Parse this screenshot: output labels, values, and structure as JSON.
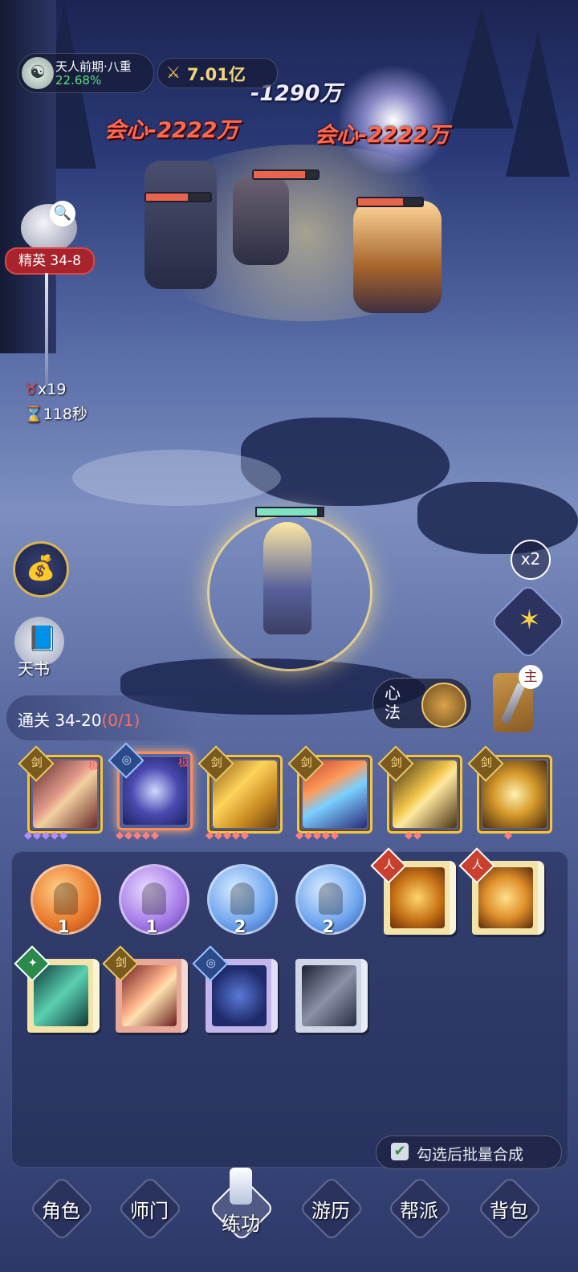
{
  "hud": {
    "realm_title": "天人前期·八重",
    "realm_progress": "22.68%",
    "power_value": "7.01亿",
    "avatar_icon": "sage-avatar-icon",
    "power_icon": "crossed-swords-icon"
  },
  "damage_texts": {
    "white_hit": "-1290万",
    "crit_left": "会心-2222万",
    "crit_right": "会心-2222万"
  },
  "stage": {
    "badge": "精英 34-8",
    "kills": "x19",
    "time": "118秒",
    "clear_label": "通关 34-20",
    "clear_progress": "(0/1)"
  },
  "side": {
    "tianshu_label": "天书",
    "speed_label": "x2",
    "xinfa_label": "心法",
    "weapon_badge": "主"
  },
  "skill_cards": [
    {
      "tag": "剑",
      "quality": "极",
      "gems": "◆◆◆◆◆",
      "gem_color": "#b48cff"
    },
    {
      "tag": "◎",
      "quality": "极",
      "gems": "◆◆◆◆◆",
      "gem_color": "#ff7f7f"
    },
    {
      "tag": "剑",
      "quality": "",
      "gems": "◆◆◆◆◆",
      "gem_color": "#ff7f7f"
    },
    {
      "tag": "剑",
      "quality": "",
      "gems": "◆◆◆◆◆",
      "gem_color": "#ff7f7f"
    },
    {
      "tag": "剑",
      "quality": "",
      "gems": "◆◆",
      "gem_color": "#ff7f7f"
    },
    {
      "tag": "剑",
      "quality": "",
      "gems": "◆",
      "gem_color": "#ff7f7f"
    }
  ],
  "orbs": [
    {
      "count": "1",
      "color": "orange"
    },
    {
      "count": "1",
      "color": "purple"
    },
    {
      "count": "2",
      "color": "blue"
    },
    {
      "count": "2",
      "color": "blue"
    }
  ],
  "books_row1": [
    {
      "tag": "人",
      "theme": "gold",
      "icon": "buddha-icon"
    },
    {
      "tag": "人",
      "theme": "gold",
      "icon": "lotus-icon"
    }
  ],
  "books_row2": [
    {
      "tag": "✦",
      "theme": "green",
      "icon": "scroll-icon"
    },
    {
      "tag": "剑",
      "theme": "red",
      "icon": "sword-icon"
    },
    {
      "tag": "◎",
      "theme": "purple",
      "icon": "constellation-icon"
    },
    {
      "tag": "",
      "theme": "gray",
      "icon": "blade-icon"
    }
  ],
  "batch_label": "勾选后批量合成",
  "nav": [
    "角色",
    "师门",
    "练功",
    "游历",
    "帮派",
    "背包"
  ],
  "nav_active_index": 2
}
